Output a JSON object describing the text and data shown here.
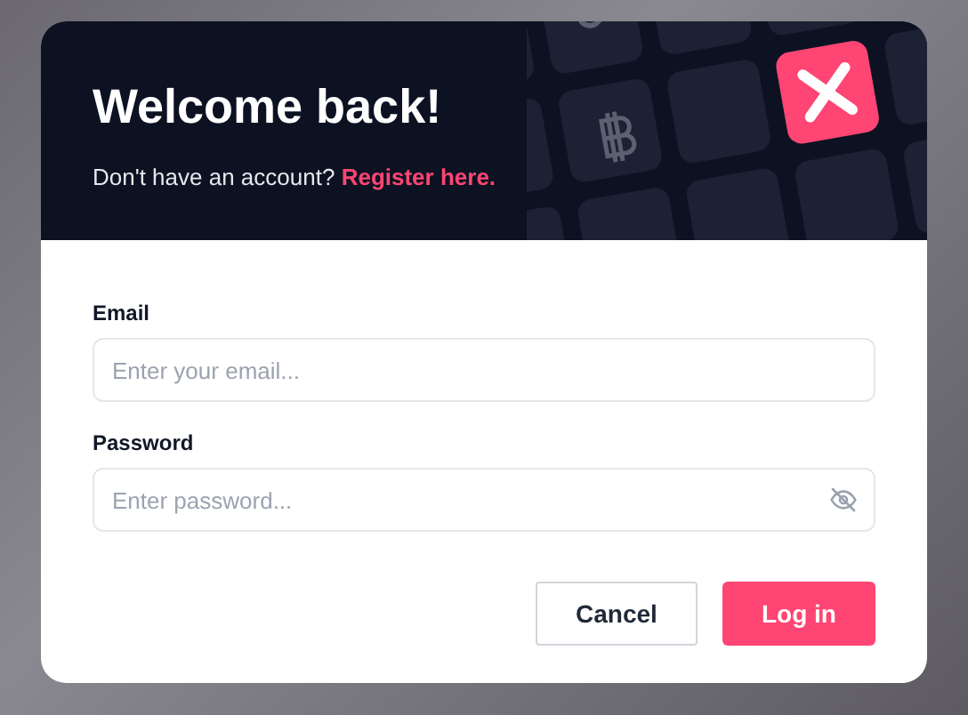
{
  "dialog": {
    "title": "Welcome back!",
    "prompt": "Don't have an account?",
    "register_link": "Register here.",
    "fields": [
      {
        "label": "Email",
        "placeholder": "Enter your email...",
        "kind": "text"
      },
      {
        "label": "Password",
        "placeholder": "Enter password...",
        "kind": "password"
      }
    ],
    "buttons": [
      {
        "label": "Cancel",
        "kind": "secondary"
      },
      {
        "label": "Log in",
        "kind": "primary"
      }
    ]
  }
}
